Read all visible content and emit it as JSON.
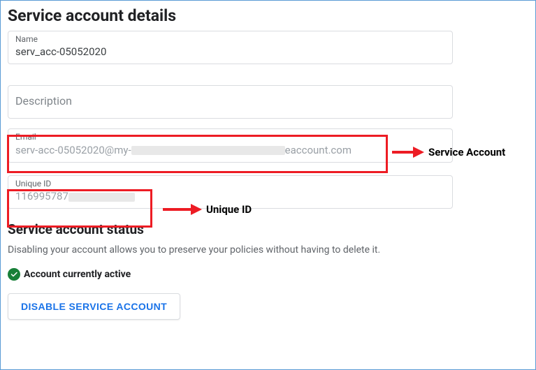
{
  "details": {
    "heading": "Service account details",
    "name_label": "Name",
    "name_value": "serv_acc-05052020",
    "description_placeholder": "Description",
    "email_label": "Email",
    "email_prefix": "serv-acc-05052020@my-",
    "email_suffix": "eaccount.com",
    "uniqueid_label": "Unique ID",
    "uniqueid_prefix": "116995787"
  },
  "status": {
    "heading": "Service account status",
    "description": "Disabling your account allows you to preserve your policies without having to delete it.",
    "active_text": "Account currently active",
    "disable_button": "DISABLE SERVICE ACCOUNT"
  },
  "annotations": {
    "service_account": "Service Account",
    "unique_id": "Unique ID"
  },
  "colors": {
    "highlight": "#ed1c24",
    "link": "#1a73e8",
    "success": "#188038"
  }
}
